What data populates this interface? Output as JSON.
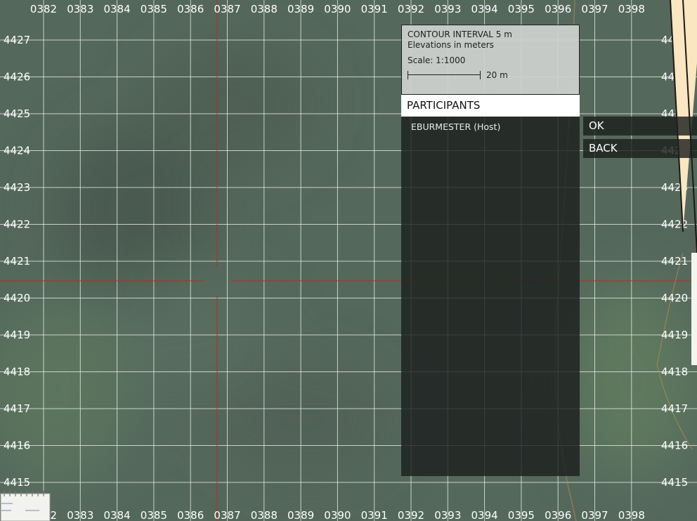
{
  "map": {
    "x_labels": [
      "0382",
      "0383",
      "0384",
      "0385",
      "0386",
      "0387",
      "0388",
      "0389",
      "0390",
      "0391",
      "0392",
      "0393",
      "0394",
      "0395",
      "0396",
      "0397",
      "0398"
    ],
    "y_labels": [
      "4427",
      "4426",
      "4425",
      "4424",
      "4423",
      "4422",
      "4421",
      "4420",
      "4419",
      "4418",
      "4417",
      "4416",
      "4415"
    ],
    "colors": {
      "terrain": "#55685c",
      "grid": "#e8ece6",
      "crosshair": "#b0301e",
      "contour": "#b58a4a"
    }
  },
  "legend": {
    "contour_interval": "CONTOUR INTERVAL 5 m",
    "elevations": "Elevations in meters",
    "scale": "Scale: 1:1000",
    "scale_bar_label": "20 m"
  },
  "participants": {
    "header": "PARTICIPANTS",
    "items": [
      "EBURMESTER (Host)"
    ]
  },
  "buttons": {
    "ok": "OK",
    "back": "BACK"
  },
  "icons": {
    "notepad": "notepad-icon"
  }
}
